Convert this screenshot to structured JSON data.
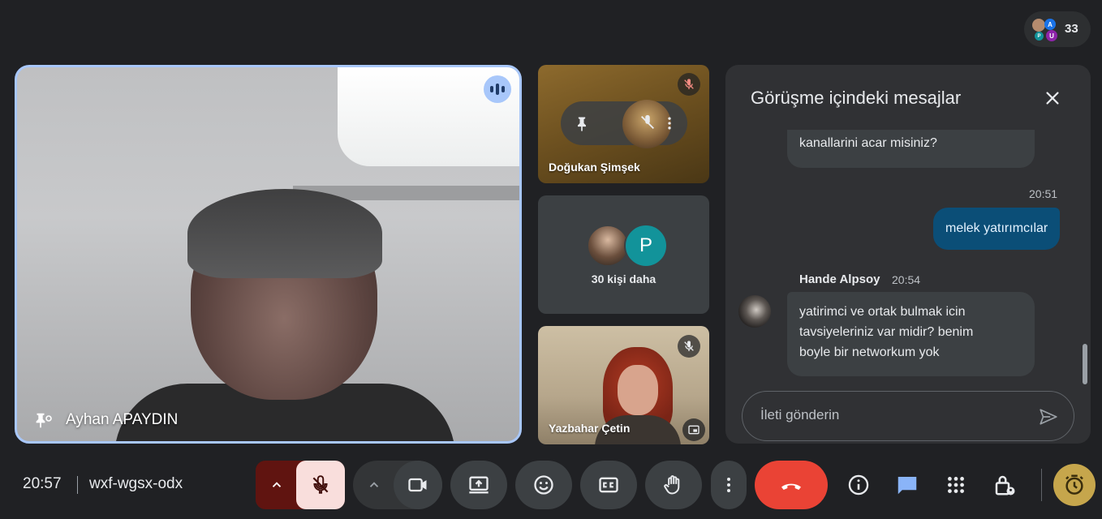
{
  "participants": {
    "count": "33",
    "mini_avatars": [
      "A",
      "U",
      "P"
    ]
  },
  "main_tile": {
    "name": "Ayhan APAYDIN"
  },
  "side_tiles": {
    "tile1": {
      "name": "Doğukan Şimşek"
    },
    "tile2": {
      "avatar_letter": "P",
      "more_text": "30 kişi daha"
    },
    "tile3": {
      "name": "Yazbahar Çetin"
    }
  },
  "chat": {
    "title": "Görüşme içindeki mesajlar",
    "messages": [
      {
        "text": "kanallarini acar misiniz?"
      },
      {
        "time": "20:51",
        "text": "melek yatırımcılar"
      },
      {
        "sender": "Hande Alpsoy",
        "time": "20:54",
        "lines": [
          "yatirimci  ve ortak bulmak icin",
          "tavsiyeleriniz var midir? benim",
          "boyle bir networkum yok"
        ]
      }
    ],
    "placeholder": "İleti gönderin"
  },
  "bottom_bar": {
    "time": "20:57",
    "meeting_code": "wxf-wgsx-odx"
  },
  "colors": {
    "accent": "#a8c7fa",
    "end_call": "#ea4335",
    "mic_off_bg": "#f9dedc",
    "chat_icon": "#8ab4f8"
  }
}
